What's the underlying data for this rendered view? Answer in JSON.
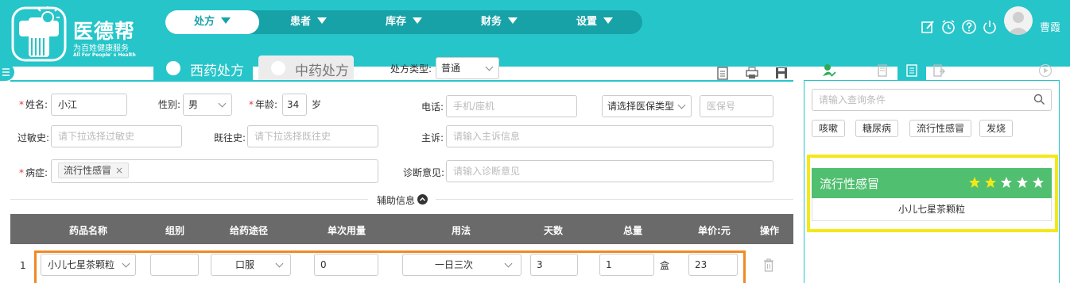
{
  "app": {
    "name": "医德帮",
    "subtitle": "为百姓健康服务",
    "slogan_en": "All For People' s Health",
    "user": "曹霞"
  },
  "nav": {
    "items": [
      "处方",
      "患者",
      "库存",
      "财务",
      "设置"
    ],
    "active_index": 0
  },
  "tabs": {
    "western": "西药处方",
    "chinese": "中药处方"
  },
  "rx_type": {
    "label": "处方类型:",
    "value": "普通"
  },
  "form": {
    "name_label": "姓名:",
    "name_value": "小江",
    "gender_label": "性别:",
    "gender_value": "男",
    "age_label": "年龄:",
    "age_value": "34",
    "age_unit": "岁",
    "phone_label": "电话:",
    "phone_placeholder": "手机/座机",
    "insurance_type_placeholder": "请选择医保类型",
    "insurance_no_placeholder": "医保号",
    "allergy_label": "过敏史:",
    "allergy_placeholder": "请下拉选择过敏史",
    "history_label": "既往史:",
    "history_placeholder": "请下拉选择既往史",
    "complaint_label": "主诉:",
    "complaint_placeholder": "请输入主诉信息",
    "disease_label": "病症:",
    "disease_tag": "流行性感冒",
    "diagnosis_label": "诊断意见:",
    "diagnosis_placeholder": "请输入诊断意见"
  },
  "aux": {
    "label": "辅助信息"
  },
  "table": {
    "headers": [
      "药品名称",
      "组别",
      "给药途径",
      "单次用量",
      "用法",
      "天数",
      "总量",
      "单价:元",
      "操作"
    ],
    "rows": [
      {
        "index": "1",
        "drug": "小儿七星茶颗粒",
        "group": "",
        "route": "口服",
        "dose": "0",
        "usage": "一日三次",
        "days": "3",
        "total": "1",
        "unit": "盒",
        "price": "23"
      }
    ]
  },
  "right_panel": {
    "search_placeholder": "请输入查询条件",
    "chips": [
      "咳嗽",
      "糖尿病",
      "流行性感冒",
      "发烧"
    ],
    "card": {
      "title": "流行性感冒",
      "rating": 2,
      "rating_max": 5,
      "item": "小儿七星茶颗粒"
    }
  },
  "colors": {
    "brand": "#26c5c9",
    "nav_bg": "#17a2a8",
    "card_green": "#50bf6f",
    "highlight_orange": "#f08a24",
    "highlight_yellow": "#f4e81a",
    "table_header": "#6a6a6a"
  },
  "icons": {
    "header": [
      "edit-icon",
      "alarm-icon",
      "help-icon",
      "power-icon"
    ],
    "toolbar": [
      "template-icon",
      "print-icon",
      "save-icon"
    ],
    "right_tabs": [
      "patient-check-icon",
      "history-icon",
      "list-icon",
      "export-icon",
      "play-icon"
    ]
  }
}
